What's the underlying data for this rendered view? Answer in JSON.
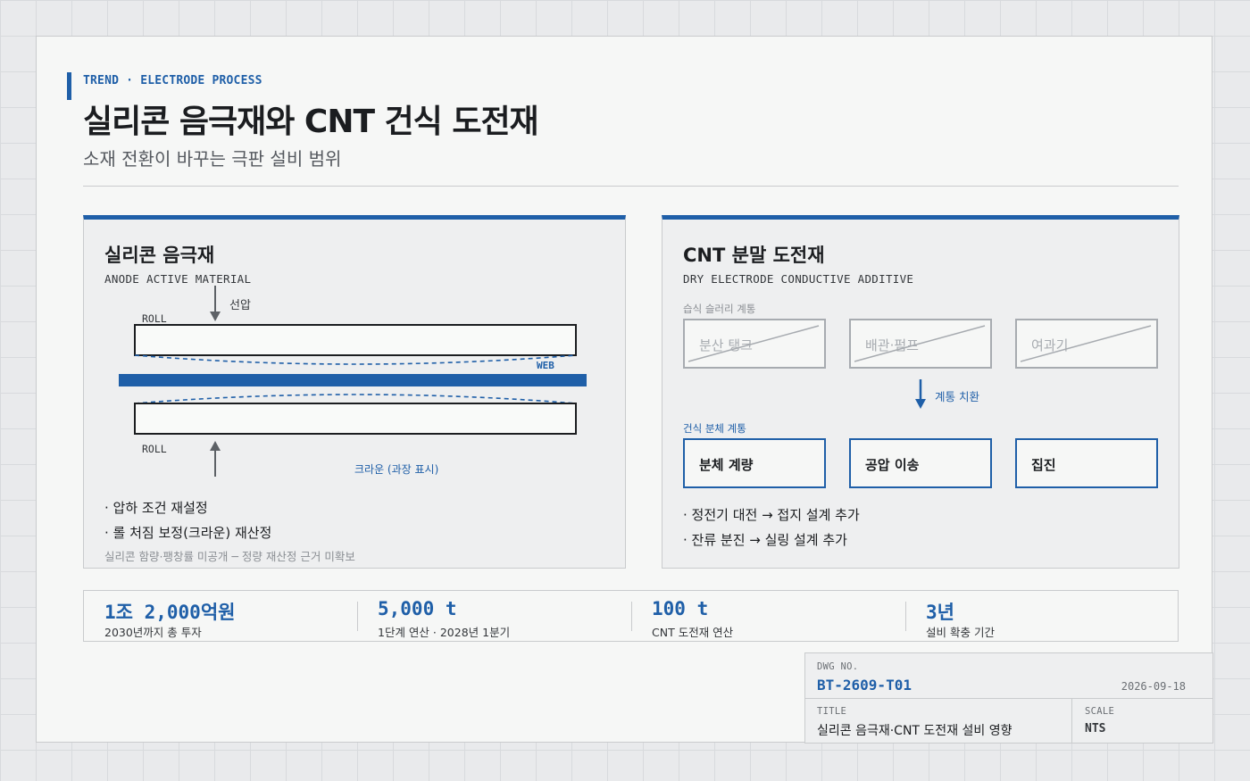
{
  "header": {
    "kicker": "TREND · ELECTRODE PROCESS",
    "title": "실리콘 음극재와 CNT 건식 도전재",
    "subtitle": "소재 전환이 바꾸는 극판 설비 범위"
  },
  "left_panel": {
    "title": "실리콘 음극재",
    "subtitle": "ANODE ACTIVE MATERIAL",
    "diagram": {
      "pressure_label": "선압",
      "roll_top_label": "ROLL",
      "roll_bottom_label": "ROLL",
      "web_label": "WEB",
      "crown_label": "크라운 (과장 표시)",
      "accent_color": "#1f5fa8"
    },
    "bullets": [
      "· 압하 조건 재설정",
      "· 롤 처짐 보정(크라운) 재산정"
    ],
    "note": "실리콘 함량·팽창률 미공개 ─ 정량 재산정 근거 미확보"
  },
  "right_panel": {
    "title": "CNT 분말 도전재",
    "subtitle": "DRY ELECTRODE CONDUCTIVE ADDITIVE",
    "wet_label": "습식 슬러리 계통",
    "wet_steps": [
      "분산 탱크",
      "배관·펌프",
      "여과기"
    ],
    "replace_label": "계통 치환",
    "dry_label": "건식 분체 계통",
    "dry_steps": [
      "분체 계량",
      "공압 이송",
      "집진"
    ],
    "bullets": [
      "· 정전기 대전 → 접지 설계 추가",
      "· 잔류 분진 → 실링 설계 추가"
    ]
  },
  "stats": [
    {
      "value": "1조 2,000억원",
      "label": "2030년까지 총 투자"
    },
    {
      "value": "5,000 t",
      "label": "1단계 연산 · 2028년 1분기"
    },
    {
      "value": "100 t",
      "label": "CNT 도전재 연산"
    },
    {
      "value": "3년",
      "label": "설비 확충 기간"
    }
  ],
  "title_block": {
    "dwg_caption": "DWG NO.",
    "dwg_no": "BT-2609-T01",
    "date": "2026-09-18",
    "title_caption": "TITLE",
    "title": "실리콘 음극재·CNT 도전재 설비 영향",
    "scale_caption": "SCALE",
    "scale": "NTS"
  }
}
